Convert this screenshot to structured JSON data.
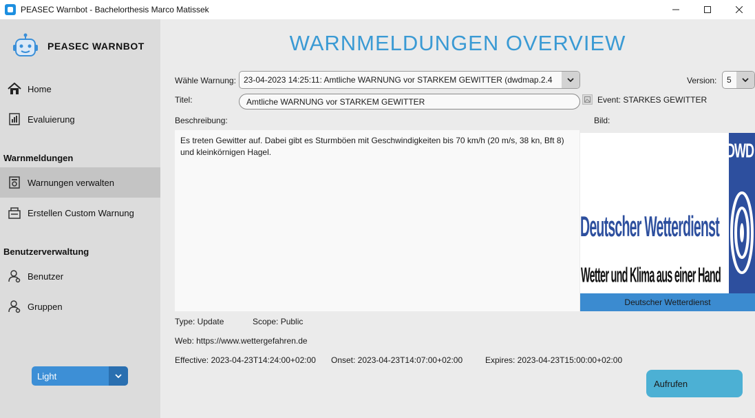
{
  "window": {
    "title": "PEASEC Warnbot - Bachelorthesis Marco Matissek",
    "minimize": "—",
    "maximize": "☐",
    "close": "✕"
  },
  "sidebar": {
    "brand": "PEASEC WARNBOT",
    "items": [
      {
        "label": "Home",
        "icon": "home-icon"
      },
      {
        "label": "Evaluierung",
        "icon": "evaluation-icon"
      }
    ],
    "section_warnings": "Warnmeldungen",
    "warning_items": [
      {
        "label": "Warnungen verwalten",
        "icon": "manage-warnings-icon",
        "active": true
      },
      {
        "label": "Erstellen Custom Warnung",
        "icon": "create-warning-icon"
      }
    ],
    "section_users": "Benutzerverwaltung",
    "user_items": [
      {
        "label": "Benutzer",
        "icon": "user-icon"
      },
      {
        "label": "Gruppen",
        "icon": "group-icon"
      }
    ],
    "theme": {
      "value": "Light"
    }
  },
  "main": {
    "title": "WARNMELDUNGEN OVERVIEW",
    "select_warning_label": "Wähle Warnung:",
    "select_warning_value": "23-04-2023 14:25:11: Amtliche WARNUNG vor STARKEM GEWITTER (dwdmap.2.4",
    "version_label": "Version:",
    "version_value": "5",
    "title_label": "Titel:",
    "title_value": "Amtliche WARNUNG vor STARKEM GEWITTER",
    "event": "Event: STARKES GEWITTER",
    "description_label": "Beschreibung:",
    "image_label": "Bild:",
    "description": "Es treten Gewitter auf. Dabei gibt es Sturmböen mit Geschwindigkeiten bis 70 km/h (20 m/s, 38 kn, Bft 8) und kleinkörnigen Hagel.",
    "image": {
      "logo_letters": "DWD",
      "logo_name": "Deutscher Wetterdienst",
      "logo_slogan": "Wetter und Klima aus einer Hand",
      "caption": "Deutscher Wetterdienst"
    },
    "type": "Type: Update",
    "scope": "Scope: Public",
    "web": "Web: https://www.wettergefahren.de",
    "effective": "Effective: 2023-04-23T14:24:00+02:00",
    "onset": "Onset: 2023-04-23T14:07:00+02:00",
    "expires": "Expires: 2023-04-23T15:00:00+02:00",
    "open_button": "Aufrufen"
  },
  "colors": {
    "accent": "#3a9ad4",
    "sidebar_bg": "#dcdcdc",
    "active_item": "#c4c4c4",
    "button": "#4cb0d4",
    "dwd_blue": "#2d4f9e"
  }
}
